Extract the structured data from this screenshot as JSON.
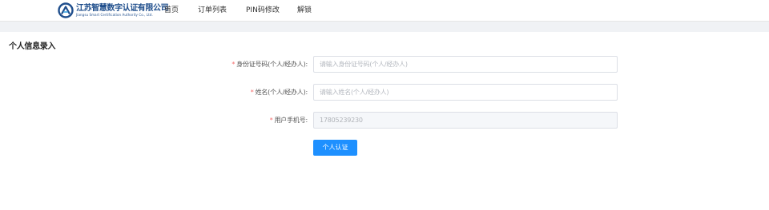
{
  "header": {
    "logo": {
      "name_cn": "江苏智慧数字认证有限公司",
      "name_en": "Jiangsu Smart Certification Authority Co., Ltd."
    },
    "nav": [
      {
        "label": "首页"
      },
      {
        "label": "订单列表"
      },
      {
        "label": "PIN码修改"
      },
      {
        "label": "解锁"
      }
    ]
  },
  "main": {
    "title": "个人信息录入",
    "required_mark": "*",
    "fields": {
      "id_number": {
        "label": "身份证号码(个人/经办人):",
        "placeholder": "请输入身份证号码(个人/经办人)",
        "value": ""
      },
      "name": {
        "label": "姓名(个人/经办人):",
        "placeholder": "请输入姓名(个人/经办人)",
        "value": ""
      },
      "phone": {
        "label": "用户手机号:",
        "value": "17805239230"
      }
    },
    "submit_label": "个人认证"
  },
  "colors": {
    "brand": "#1f4e8c",
    "primary_button": "#1e90ff",
    "required": "#f56c6c",
    "page_bg": "#f0f2f5"
  }
}
